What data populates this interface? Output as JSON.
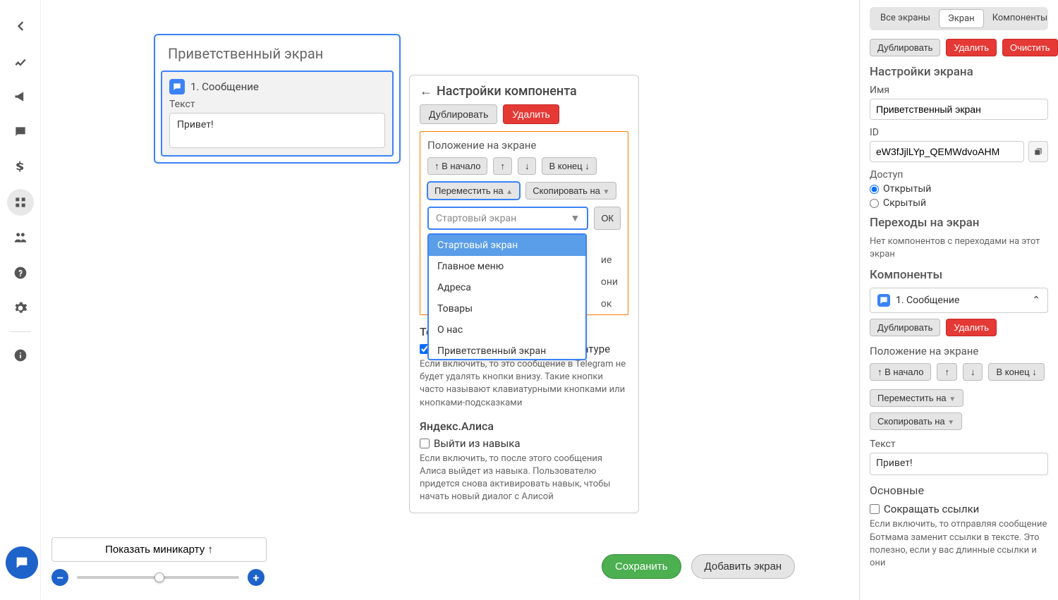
{
  "nav": {
    "back": "back-icon",
    "items": [
      "chart",
      "megaphone",
      "chat",
      "dollar",
      "flow",
      "users",
      "help",
      "settings",
      "info"
    ]
  },
  "screen": {
    "title": "Приветственный экран",
    "component": {
      "badge": "1. Сообщение",
      "text_label": "Текст",
      "text_value": "Привет!"
    }
  },
  "compPanel": {
    "title": "Настройки компонента",
    "dup": "Дублировать",
    "del": "Удалить",
    "posTitle": "Положение на экране",
    "toStart": "↑ В начало",
    "up": "↑",
    "down": "↓",
    "toEnd": "В конец ↓",
    "moveTo": "Переместить на",
    "copyTo": "Скопировать на",
    "selectPlaceholder": "Стартовый экран",
    "ok": "ОК",
    "options": [
      "Стартовый экран",
      "Главное меню",
      "Адреса",
      "Товары",
      "О нас",
      "Приветственный экран"
    ],
    "telegram": {
      "title": "Telegram",
      "checkbox": "Не скрывать кнопки на клавиатуре",
      "hint": "Если включить, то это сообщение в Telegram не будет удалять кнопки внизу. Такие кнопки часто называют клавиатурными кнопками или кнопками-подсказками"
    },
    "alice": {
      "title": "Яндекс.Алиса",
      "checkbox": "Выйти из навыка",
      "hint": "Если включить, то после этого сообщения Алиса выйдет из навыка. Пользователю придется снова активировать навык, чтобы начать новый диалог с Алисой"
    },
    "hiddenLines": [
      "ие",
      "они",
      "ок"
    ]
  },
  "bottom": {
    "minimap": "Показать миникарту ↑",
    "save": "Сохранить",
    "addScreen": "Добавить экран"
  },
  "right": {
    "tabs": [
      "Все экраны",
      "Экран",
      "Компоненты"
    ],
    "dup": "Дублировать",
    "del": "Удалить",
    "clear": "Очистить",
    "settingsTitle": "Настройки экрана",
    "nameLabel": "Имя",
    "nameValue": "Приветственный экран",
    "idLabel": "ID",
    "idValue": "eW3fJjlLYp_QEMWdvoAHM",
    "accessLabel": "Доступ",
    "accessOpen": "Открытый",
    "accessHidden": "Скрытый",
    "transTitle": "Переходы на экран",
    "transEmpty": "Нет компонентов с переходами на этот экран",
    "compsTitle": "Компоненты",
    "compItem": "1. Сообщение",
    "compDup": "Дублировать",
    "compDel": "Удалить",
    "posTitle": "Положение на экране",
    "toStart": "↑ В начало",
    "up": "↑",
    "down": "↓",
    "toEnd": "В конец ↓",
    "moveTo": "Переместить на",
    "copyTo": "Скопировать на",
    "textLabel": "Текст",
    "textValue": "Привет!",
    "mainTitle": "Основные",
    "shortLinks": "Сокращать ссылки",
    "shortHint": "Если включить, то отправляя сообщение Ботмама заменит ссылки в тексте. Это полезно, если у вас длинные ссылки и они"
  }
}
